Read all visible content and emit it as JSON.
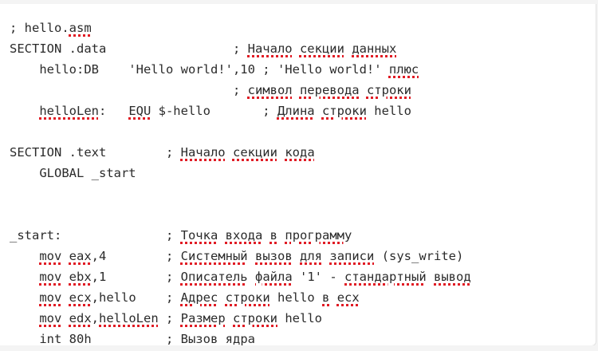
{
  "editor": {
    "lines": [
      "; hello.asm",
      "SECTION .data                 ; Начало секции данных",
      "    hello:DB    'Hello world!',10 ; 'Hello world!' плюс",
      "                              ; символ перевода строки",
      "    helloLen:   EQU $-hello       ; Длина строки hello",
      "",
      "SECTION .text        ; Начало секции кода",
      "    GLOBAL _start",
      "",
      "",
      "_start:              ; Точка входа в программу",
      "    mov eax,4        ; Системный вызов для записи (sys_write)",
      "    mov ebx,1        ; Описатель файла '1' - стандартный вывод",
      "    mov ecx,hello    ; Адрес строки hello в ecx",
      "    mov edx,helloLen ; Размер строки hello",
      "    int 80h          ; Вызов ядра"
    ]
  }
}
